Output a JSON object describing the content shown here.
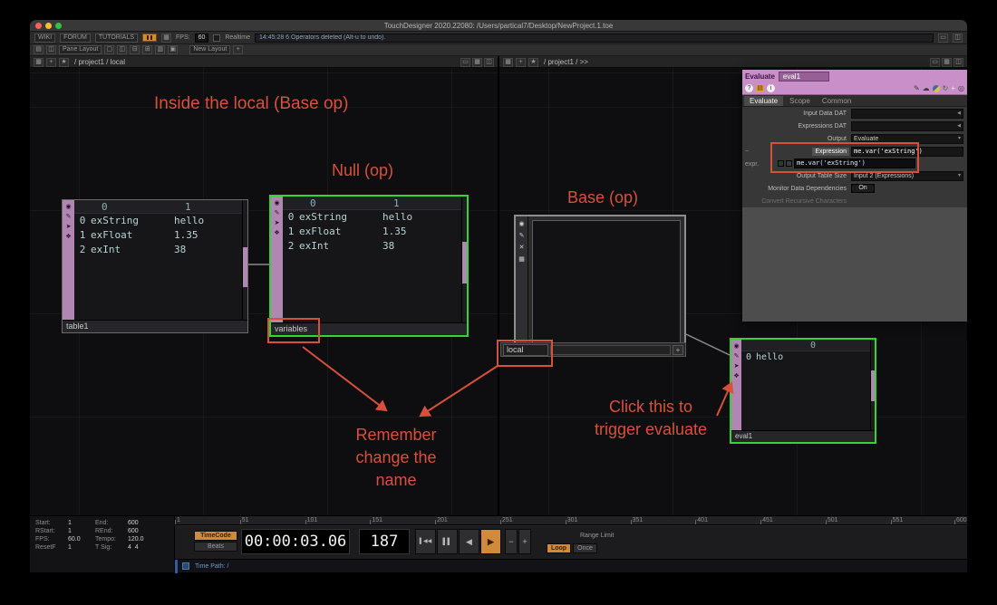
{
  "colors": {
    "annotation_red": "#d9503a",
    "selection_green": "#35d435",
    "node_pink": "#b286b2",
    "accent_orange": "#d08a3a",
    "param_header_pink": "#c98fc9"
  },
  "titlebar": {
    "title": "TouchDesigner 2020.22080: /Users/partical7/Desktop/NewProject.1.toe"
  },
  "menubar": {
    "wiki": "WIKI",
    "forum": "FORUM",
    "tutorials": "TUTORIALS",
    "fps_label": "FPS:",
    "fps_value": "60",
    "realtime": "Realtime",
    "status": "14:45:28 6 Operators deleted (Alt-u to undo)."
  },
  "toolbar": {
    "pane_layout": "Pane Layout",
    "new_layout": "New Layout",
    "add": "+"
  },
  "panes": {
    "left_path": "/ project1 / local",
    "right_path": "/ project1 / >>"
  },
  "annotations": {
    "inside_local": "Inside the local (Base op)",
    "null_op": "Null (op)",
    "base_op": "Base (op)",
    "click_line1": "Click this to",
    "click_line2": "trigger evaluate",
    "remember_line1": "Remember",
    "remember_line2": "change the",
    "remember_line3": "name"
  },
  "nodes": {
    "table1": {
      "name": "table1",
      "col_headers": [
        "0",
        "1"
      ],
      "rows": [
        [
          "0",
          "exString",
          "hello"
        ],
        [
          "1",
          "exFloat",
          "1.35"
        ],
        [
          "2",
          "exInt",
          "38"
        ]
      ]
    },
    "variables": {
      "name": "variables",
      "col_headers": [
        "0",
        "1"
      ],
      "rows": [
        [
          "0",
          "exString",
          "hello"
        ],
        [
          "1",
          "exFloat",
          "1.35"
        ],
        [
          "2",
          "exInt",
          "38"
        ]
      ]
    },
    "local": {
      "name": "local"
    },
    "eval1": {
      "name": "eval1",
      "col_headers": [
        "0"
      ],
      "rows": [
        [
          "0",
          "hello"
        ]
      ]
    }
  },
  "params": {
    "op_type": "Evaluate",
    "op_name": "eval1",
    "tabs": [
      "Evaluate",
      "Scope",
      "Common"
    ],
    "expr_gutter_minus": "−",
    "expr_gutter": "expr.",
    "rows": [
      {
        "label": "Input Data DAT",
        "value": ""
      },
      {
        "label": "Expressions DAT",
        "value": ""
      },
      {
        "label": "Output",
        "value": "Evaluate"
      },
      {
        "label": "Expression",
        "value": "me.var('exString')"
      },
      {
        "label": "Output Table Size",
        "value": "Input 2 (Expressions)"
      },
      {
        "label": "Monitor Data Dependencies",
        "value": "On"
      },
      {
        "label": "Convert Recursive Characters",
        "value": ""
      }
    ],
    "expression_echo": "me.var('exString')"
  },
  "timeline": {
    "info": {
      "start_label": "Start:",
      "start": "1",
      "end_label": "End:",
      "end": "600",
      "rstart_label": "RStart:",
      "rstart": "1",
      "rend_label": "REnd:",
      "rend": "600",
      "fps_label": "FPS:",
      "fps": "60.0",
      "tempo_label": "Tempo:",
      "tempo": "120.0",
      "resetf_label": "ResetF",
      "resetf": "1",
      "tsig_label": "T Sig:",
      "tsig": "4  4"
    },
    "ruler_ticks": [
      1,
      51,
      101,
      151,
      201,
      251,
      301,
      351,
      401,
      451,
      501,
      551,
      600
    ],
    "timecode": "TimeCode",
    "beats": "Beats",
    "time": "00:00:03.06",
    "frame": "187",
    "range_limit": "Range Limit",
    "loop": "Loop",
    "once": "Once",
    "time_path": "Time Path: /"
  },
  "icons": {
    "viewer": "◉",
    "pen": "✎",
    "arrow": "➤",
    "flag": "❖",
    "close": "✕",
    "grid": "▦",
    "star": "★",
    "plus": "+",
    "minus": "−",
    "dropdown": "▾",
    "play": "▶",
    "reverse": "◀",
    "pause": "▌▌",
    "jump_start": "▌◀◀",
    "help": "?",
    "info": "i",
    "folder": "▤",
    "cloud": "☁",
    "refresh": "↻",
    "target": "◎",
    "layout_a": "▢",
    "layout_b": "◫",
    "layout_c": "⊟",
    "layout_d": "⊞",
    "layout_e": "▥",
    "layout_f": "▣",
    "pane": "▤",
    "split": "◫",
    "dock": "▭"
  }
}
